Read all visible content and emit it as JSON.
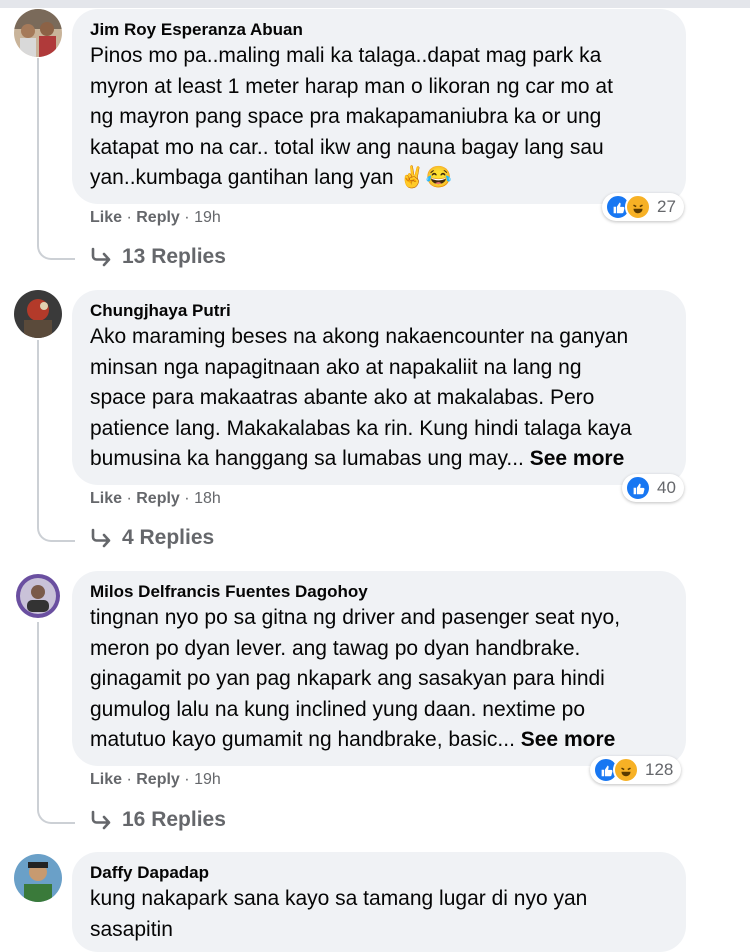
{
  "comments": [
    {
      "author": "Jim Roy Esperanza Abuan",
      "lines": [
        "Pinos mo pa..maling mali ka talaga..dapat mag park ka",
        "myron at least 1 meter harap man o likoran ng car mo at",
        "ng mayron pang space pra makapamaniubra ka or ung",
        "katapat mo na car.. total ikw ang nauna bagay lang sau",
        "yan..kumbaga gantihan lang yan"
      ],
      "emojis": "✌😂",
      "see_more": "",
      "like": "Like",
      "reply": "Reply",
      "time": "19h",
      "reaction_count": "27",
      "replies": "13 Replies"
    },
    {
      "author": "Chungjhaya Putri",
      "lines": [
        "Ako maraming beses na akong nakaencounter na ganyan",
        "minsan nga napagitnaan ako at napakaliit na lang ng",
        "space para makaatras abante ako at makalabas. Pero",
        "patience lang. Makakalabas ka rin. Kung hindi talaga kaya",
        "bumusina ka hanggang sa lumabas ung may..."
      ],
      "see_more": "See more",
      "like": "Like",
      "reply": "Reply",
      "time": "18h",
      "reaction_count": "40",
      "replies": "4 Replies"
    },
    {
      "author": "Milos Delfrancis Fuentes Dagohoy",
      "lines": [
        "tingnan nyo po sa gitna ng driver and pasenger seat nyo,",
        "meron po dyan lever. ang tawag po dyan handbrake.",
        "ginagamit po yan pag nkapark ang sasakyan para hindi",
        "gumulog lalu na kung inclined yung daan. nextime po",
        "matutuo kayo gumamit ng handbrake, basic..."
      ],
      "see_more": "See more",
      "like": "Like",
      "reply": "Reply",
      "time": "19h",
      "reaction_count": "128",
      "replies": "16 Replies"
    },
    {
      "author": "Daffy Dapadap",
      "lines": [
        "kung nakapark sana kayo sa tamang lugar di nyo yan",
        "sasapitin"
      ]
    }
  ],
  "meta_separator": "·",
  "reaction_icons": [
    "like-icon",
    "haha-icon"
  ],
  "colors": {
    "like": "#1877f2",
    "haha": "#f7b125",
    "bubble": "#f0f2f5",
    "meta": "#65676b"
  }
}
